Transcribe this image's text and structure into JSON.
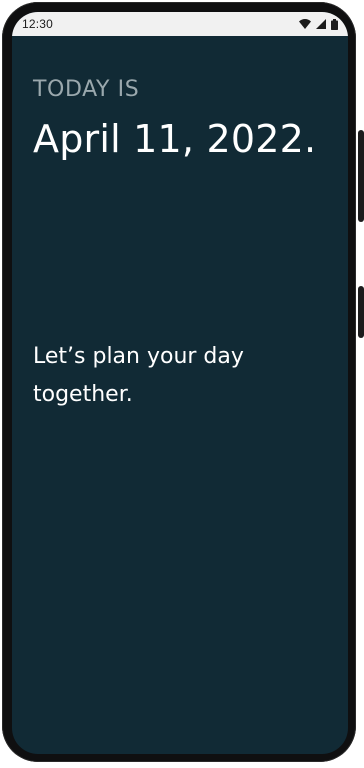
{
  "status_bar": {
    "time": "12:30",
    "icons": [
      "wifi-icon",
      "cellular-signal-icon",
      "battery-icon"
    ]
  },
  "main": {
    "label": "TODAY IS",
    "date": "April 11, 2022.",
    "message": "Let’s plan your day together."
  },
  "colors": {
    "screen_background": "#112a35",
    "status_bar_background": "#f1f1f1",
    "label_text": "#9aa8ad",
    "primary_text": "#ffffff",
    "frame": "#0f0f10"
  }
}
